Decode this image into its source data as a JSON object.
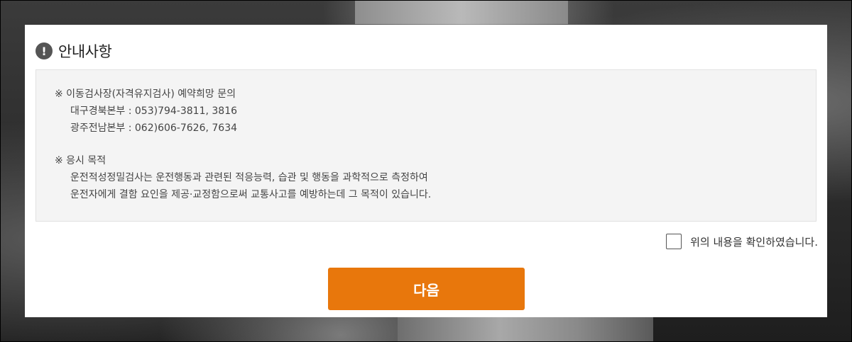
{
  "panel": {
    "title": "안내사항",
    "title_icon": "exclamation-circle-icon"
  },
  "notice": {
    "sections": [
      {
        "heading": "※ 이동검사장(자격유지검사) 예약희망 문의",
        "lines": [
          "대구경북본부 : 053)794-3811, 3816",
          "광주전남본부 : 062)606-7626, 7634"
        ]
      },
      {
        "heading": "※ 응시 목적",
        "lines": [
          "운전적성정밀검사는 운전행동과 관련된 적응능력, 습관 및 행동을 과학적으로 측정하여",
          "운전자에게 결함 요인을 제공·교정함으로써 교통사고를 예방하는데 그 목적이 있습니다."
        ]
      }
    ]
  },
  "confirm": {
    "label": "위의 내용을 확인하였습니다.",
    "checked": false
  },
  "actions": {
    "next_label": "다음",
    "accent_color": "#e8770c"
  }
}
